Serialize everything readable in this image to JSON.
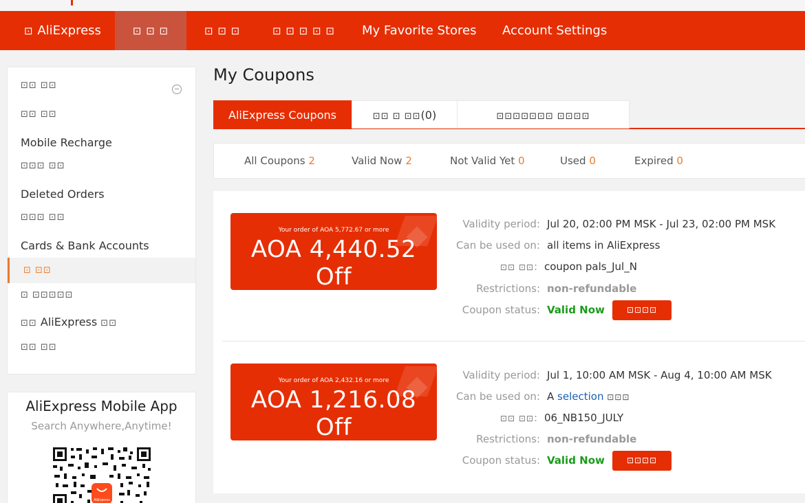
{
  "nav": {
    "logo_glyph": "⊡",
    "logo_text": "AliExpress",
    "item_orders": "⊡ ⊡ ⊡",
    "item_messages": "⊡ ⊡ ⊡",
    "item_wishlist": "⊡ ⊡ ⊡ ⊡ ⊡",
    "item_stores": "My Favorite Stores",
    "item_settings": "Account Settings"
  },
  "sidebar": {
    "items": [
      {
        "label": "⊡⊡  ⊡⊡"
      },
      {
        "label": "⊡⊡  ⊡⊡"
      },
      {
        "label": "Mobile Recharge"
      },
      {
        "label": "⊡⊡⊡  ⊡⊡"
      },
      {
        "label": "Deleted Orders"
      },
      {
        "label": "⊡⊡⊡  ⊡⊡"
      },
      {
        "label": "Cards & Bank Accounts"
      },
      {
        "label": "⊡  ⊡⊡"
      },
      {
        "label": "⊡  ⊡⊡⊡⊡⊡"
      },
      {
        "label_pre": "⊡⊡",
        "label_text": "AliExpress",
        "label_post": "⊡⊡"
      },
      {
        "label": "⊡⊡  ⊡⊡"
      }
    ]
  },
  "app_box": {
    "title": "AliExpress Mobile App",
    "subtitle": "Search Anywhere,Anytime!",
    "qr_badge": "AliExpress"
  },
  "page": {
    "title": "My Coupons"
  },
  "tabs": {
    "aliexpress": "AliExpress Coupons",
    "store_glyph": "⊡⊡ ⊡ ⊡⊡",
    "store_count": "(0)",
    "other": "⊡⊡⊡⊡⊡⊡⊡ ⊡⊡⊡⊡"
  },
  "filters": [
    {
      "label": "All Coupons",
      "count": "2"
    },
    {
      "label": "Valid Now",
      "count": "2"
    },
    {
      "label": "Not Valid Yet",
      "count": "0"
    },
    {
      "label": "Used",
      "count": "0"
    },
    {
      "label": "Expired",
      "count": "0"
    }
  ],
  "labels": {
    "validity": "Validity period:",
    "usable": "Can be used on:",
    "code_glyph": "⊡⊡ ⊡⊡",
    "restrictions": "Restrictions:",
    "status": "Coupon status:",
    "use_button": "⊡⊡⊡⊡"
  },
  "coupons": [
    {
      "min_order": "Your order of AOA 5,772.67 or more",
      "amount": "AOA 4,440.52 Off",
      "validity": "Jul 20, 02:00 PM MSK - Jul 23, 02:00 PM MSK",
      "usable": "all items in AliExpress",
      "code": "coupon pals_Jul_N",
      "restrictions": "non-refundable",
      "status": "Valid Now"
    },
    {
      "min_order": "Your order of AOA 2,432.16 or more",
      "amount": "AOA 1,216.08 Off",
      "validity": "Jul 1, 10:00 AM MSK - Aug 4, 10:00 AM MSK",
      "usable_prefix": "A",
      "usable_link": "selection",
      "usable_glyph": "⊡⊡⊡",
      "code": "06_NB150_JULY",
      "restrictions": "non-refundable",
      "status": "Valid Now"
    }
  ],
  "colors": {
    "brand": "#e62e04",
    "accent_orange": "#e87b2d",
    "valid_green": "#1a9c1a",
    "link_blue": "#1a5fb4"
  }
}
